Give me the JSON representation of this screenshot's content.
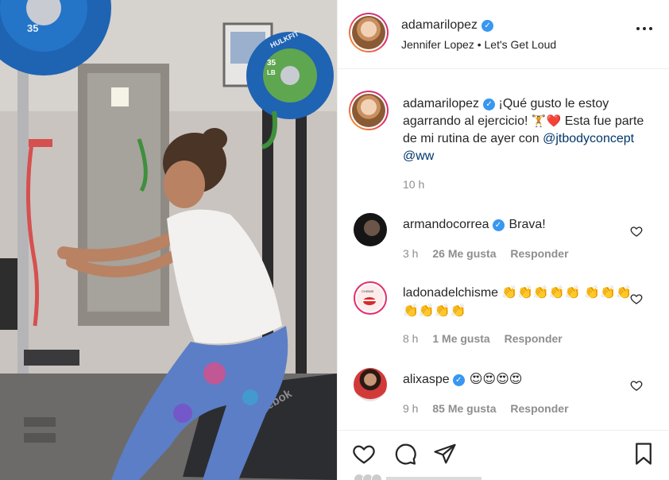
{
  "post": {
    "author": "adamarilopez",
    "audio": "Jennifer Lopez • Let's Get Loud",
    "caption_author": "adamarilopez",
    "caption_text_1": "¡Qué gusto le estoy agarrando al ejercicio!",
    "caption_emojis": "🏋️❤️",
    "caption_text_2": "Esta fue parte de mi rutina de ayer con",
    "mention_1": "@jtbodyconcept",
    "mention_2": "@ww",
    "time": "10 h"
  },
  "comments": [
    {
      "user": "armandocorrea",
      "verified": true,
      "text": "Brava!",
      "time": "3 h",
      "likes": "26 Me gusta",
      "reply": "Responder"
    },
    {
      "user": "ladonadelchisme",
      "verified": false,
      "text": "👏👏👏👏👏 👏👏👏👏👏👏👏",
      "time": "8 h",
      "likes": "1 Me gusta",
      "reply": "Responder"
    },
    {
      "user": "alixaspe",
      "verified": true,
      "text": "😍😍😍😍",
      "time": "9 h",
      "likes": "85 Me gusta",
      "reply": "Responder"
    }
  ],
  "media": {
    "plate_brand": "HULKFIT",
    "plate_weight": "35",
    "plate_unit": "LB",
    "bench_brand": "Reebok"
  },
  "icons": {
    "verified": "verified-badge-icon",
    "more": "more-options-icon",
    "like": "heart-icon",
    "comment": "comment-icon",
    "share": "share-icon",
    "save": "bookmark-icon"
  },
  "colors": {
    "verified": "#3897f0",
    "mention": "#00376b",
    "secondary_text": "#8e8e8e"
  }
}
